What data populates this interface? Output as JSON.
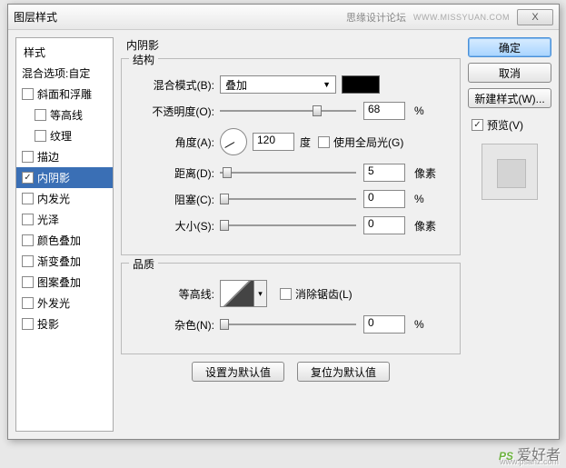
{
  "titlebar": {
    "title": "图层样式",
    "subtitle": "思缘设计论坛",
    "url": "WWW.MISSYUAN.COM",
    "close": "X"
  },
  "sidebar": {
    "header": "样式",
    "blend": "混合选项:自定",
    "items": [
      {
        "label": "斜面和浮雕",
        "checked": false,
        "indent": false
      },
      {
        "label": "等高线",
        "checked": false,
        "indent": true
      },
      {
        "label": "纹理",
        "checked": false,
        "indent": true
      },
      {
        "label": "描边",
        "checked": false,
        "indent": false
      },
      {
        "label": "内阴影",
        "checked": true,
        "indent": false,
        "selected": true
      },
      {
        "label": "内发光",
        "checked": false,
        "indent": false
      },
      {
        "label": "光泽",
        "checked": false,
        "indent": false
      },
      {
        "label": "颜色叠加",
        "checked": false,
        "indent": false
      },
      {
        "label": "渐变叠加",
        "checked": false,
        "indent": false
      },
      {
        "label": "图案叠加",
        "checked": false,
        "indent": false
      },
      {
        "label": "外发光",
        "checked": false,
        "indent": false
      },
      {
        "label": "投影",
        "checked": false,
        "indent": false
      }
    ]
  },
  "panel": {
    "title": "内阴影",
    "structure": {
      "legend": "结构",
      "blend_label": "混合模式(B):",
      "blend_value": "叠加",
      "opacity_label": "不透明度(O):",
      "opacity_value": "68",
      "opacity_unit": "%",
      "angle_label": "角度(A):",
      "angle_value": "120",
      "angle_unit": "度",
      "global_label": "使用全局光(G)",
      "distance_label": "距离(D):",
      "distance_value": "5",
      "distance_unit": "像素",
      "choke_label": "阻塞(C):",
      "choke_value": "0",
      "choke_unit": "%",
      "size_label": "大小(S):",
      "size_value": "0",
      "size_unit": "像素"
    },
    "quality": {
      "legend": "品质",
      "contour_label": "等高线:",
      "antialias_label": "消除锯齿(L)",
      "noise_label": "杂色(N):",
      "noise_value": "0",
      "noise_unit": "%"
    },
    "buttons": {
      "default": "设置为默认值",
      "reset": "复位为默认值"
    }
  },
  "right": {
    "ok": "确定",
    "cancel": "取消",
    "newstyle": "新建样式(W)...",
    "preview_label": "预览(V)"
  },
  "watermark": {
    "logo": "PS",
    "text": "爱好者",
    "url": "www.psahz.com"
  }
}
